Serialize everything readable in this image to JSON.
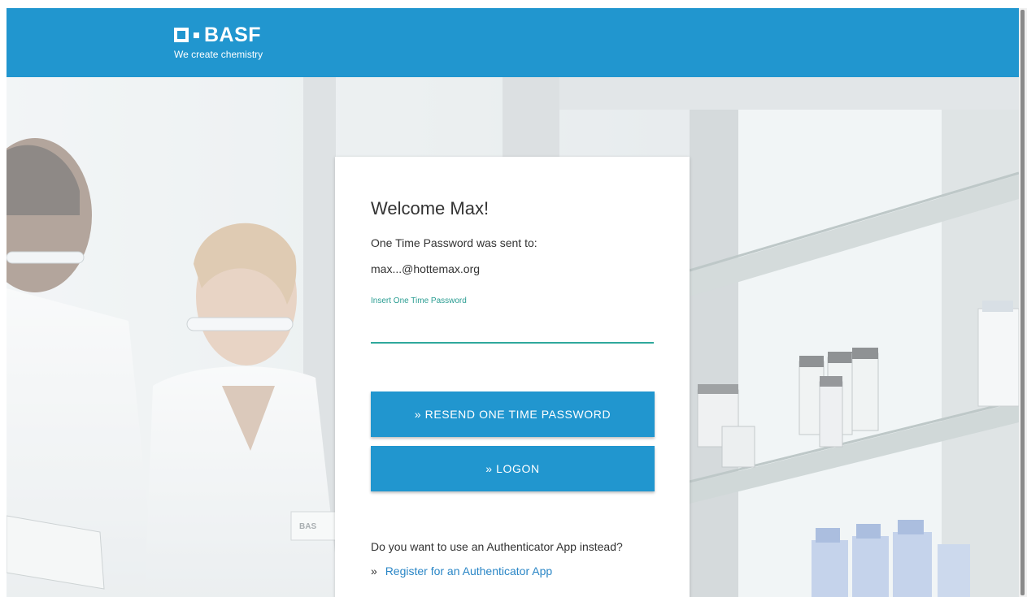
{
  "header": {
    "brand": "BASF",
    "tagline": "We create chemistry",
    "color": "#2196cf"
  },
  "card": {
    "title": "Welcome Max!",
    "sent_to_label": "One Time Password was sent to:",
    "email": "max...@hottemax.org",
    "otp_field": {
      "label": "Insert One Time Password",
      "value": "",
      "placeholder": ""
    },
    "buttons": {
      "resend": "» RESEND ONE TIME PASSWORD",
      "logon": "» LOGON"
    },
    "authenticator": {
      "question": "Do you want to use an Authenticator App instead?",
      "link_prefix": "»",
      "link_label": "Register for an Authenticator App"
    }
  },
  "colors": {
    "primary": "#2196cf",
    "accent_teal": "#2fa89c",
    "link": "#2a86c6"
  }
}
